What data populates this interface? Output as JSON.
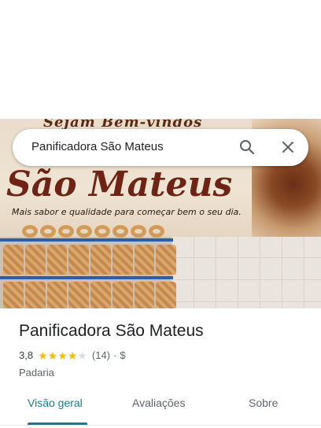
{
  "search": {
    "query": "Panificadora São Mateus"
  },
  "photo": {
    "banner_top_text": "Sejam Bem-vindos",
    "banner_name": "São Mateus",
    "banner_tagline": "Mais sabor e qualidade para começar bem o seu dia."
  },
  "place": {
    "name": "Panificadora São Mateus",
    "rating": "3,8",
    "stars": 3.8,
    "review_count": "(14)",
    "separator": "·",
    "price": "$",
    "category": "Padaria"
  },
  "tabs": [
    {
      "label": "Visão geral",
      "active": true
    },
    {
      "label": "Avaliações",
      "active": false
    },
    {
      "label": "Sobre",
      "active": false
    }
  ],
  "colors": {
    "accent": "#137e8b",
    "star": "#fbbc04"
  }
}
